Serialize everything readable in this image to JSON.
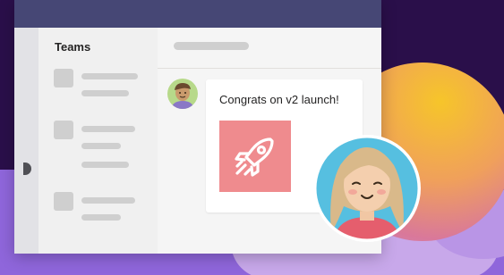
{
  "sidebar": {
    "title": "Teams"
  },
  "chat": {
    "message": "Congrats on v2 launch!"
  },
  "icons": {
    "attachment": "rocket-icon",
    "sender_avatar": "male-avatar-icon",
    "participant_avatar": "female-avatar-icon"
  },
  "colors": {
    "titlebar": "#464775",
    "rocket_tile": "#ef8b8e",
    "background_top": "#2a0f4a",
    "background_bottom": "#8f66db"
  }
}
